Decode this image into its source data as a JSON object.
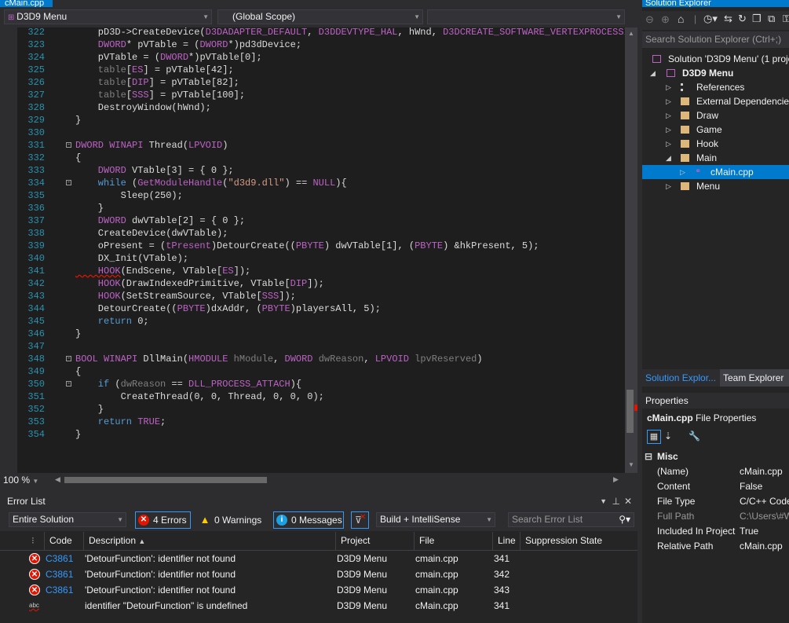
{
  "tab": {
    "title": "cMain.cpp"
  },
  "nav": {
    "project_combo": "D3D9 Menu",
    "scope_combo": "(Global Scope)",
    "member_combo": ""
  },
  "editor": {
    "lines": [
      {
        "n": "322",
        "tokens": [
          [
            "d",
            "    pD3D->CreateDevice("
          ],
          [
            "m",
            "D3DADAPTER_DEFAULT"
          ],
          [
            "d",
            ", "
          ],
          [
            "m",
            "D3DDEVTYPE_HAL"
          ],
          [
            "d",
            ", hWnd, "
          ],
          [
            "m",
            "D3DCREATE_SOFTWARE_VERTEXPROCESSING"
          ],
          [
            "d",
            ", "
          ]
        ]
      },
      {
        "n": "323",
        "tokens": [
          [
            "m",
            "    DWORD"
          ],
          [
            "d",
            "* pVTable = ("
          ],
          [
            "m",
            "DWORD"
          ],
          [
            "d",
            "*)pd3dDevice;"
          ]
        ]
      },
      {
        "n": "324",
        "tokens": [
          [
            "d",
            "    pVTable = ("
          ],
          [
            "m",
            "DWORD"
          ],
          [
            "d",
            "*)pVTable[0];"
          ]
        ]
      },
      {
        "n": "325",
        "tokens": [
          [
            "g",
            "    table"
          ],
          [
            "d",
            "["
          ],
          [
            "m",
            "ES"
          ],
          [
            "d",
            "] = pVTable[42];"
          ]
        ]
      },
      {
        "n": "326",
        "tokens": [
          [
            "g",
            "    table"
          ],
          [
            "d",
            "["
          ],
          [
            "m",
            "DIP"
          ],
          [
            "d",
            "] = pVTable[82];"
          ]
        ]
      },
      {
        "n": "327",
        "tokens": [
          [
            "g",
            "    table"
          ],
          [
            "d",
            "["
          ],
          [
            "m",
            "SSS"
          ],
          [
            "d",
            "] = pVTable[100];"
          ]
        ]
      },
      {
        "n": "328",
        "tokens": [
          [
            "d",
            "    DestroyWindow(hWnd);"
          ]
        ]
      },
      {
        "n": "329",
        "tokens": [
          [
            "d",
            "}"
          ]
        ]
      },
      {
        "n": "330",
        "tokens": []
      },
      {
        "n": "331",
        "fold": "-",
        "tokens": [
          [
            "m",
            "DWORD "
          ],
          [
            "m",
            "WINAPI"
          ],
          [
            "d",
            " Thread("
          ],
          [
            "m",
            "LPVOID"
          ],
          [
            "d",
            ")"
          ]
        ]
      },
      {
        "n": "332",
        "tokens": [
          [
            "d",
            "{"
          ]
        ]
      },
      {
        "n": "333",
        "tokens": [
          [
            "m",
            "    DWORD"
          ],
          [
            "d",
            " VTable[3] = { 0 };"
          ]
        ]
      },
      {
        "n": "334",
        "fold": "-",
        "tokens": [
          [
            "k",
            "    while"
          ],
          [
            "d",
            " ("
          ],
          [
            "m",
            "GetModuleHandle"
          ],
          [
            "d",
            "("
          ],
          [
            "s",
            "\"d3d9.dll\""
          ],
          [
            "d",
            ") == "
          ],
          [
            "m",
            "NULL"
          ],
          [
            "d",
            "){"
          ]
        ]
      },
      {
        "n": "335",
        "tokens": [
          [
            "d",
            "        Sleep(250);"
          ]
        ]
      },
      {
        "n": "336",
        "tokens": [
          [
            "d",
            "    }"
          ]
        ]
      },
      {
        "n": "337",
        "tokens": [
          [
            "m",
            "    DWORD"
          ],
          [
            "d",
            " dwVTable[2] = { 0 };"
          ]
        ]
      },
      {
        "n": "338",
        "tokens": [
          [
            "d",
            "    CreateDevice(dwVTable);"
          ]
        ]
      },
      {
        "n": "339",
        "tokens": [
          [
            "d",
            "    oPresent = ("
          ],
          [
            "m",
            "tPresent"
          ],
          [
            "d",
            ")DetourCreate(("
          ],
          [
            "m",
            "PBYTE"
          ],
          [
            "d",
            ") dwVTable[1], ("
          ],
          [
            "m",
            "PBYTE"
          ],
          [
            "d",
            ") &hkPresent, 5);"
          ]
        ]
      },
      {
        "n": "340",
        "tokens": [
          [
            "d",
            "    DX_Init(VTable);"
          ]
        ]
      },
      {
        "n": "341",
        "tokens": [
          [
            "e",
            "    HOOK"
          ],
          [
            "d",
            "(EndScene, VTable["
          ],
          [
            "m",
            "ES"
          ],
          [
            "d",
            "]);"
          ]
        ]
      },
      {
        "n": "342",
        "tokens": [
          [
            "m",
            "    HOOK"
          ],
          [
            "d",
            "(DrawIndexedPrimitive, VTable["
          ],
          [
            "m",
            "DIP"
          ],
          [
            "d",
            "]);"
          ]
        ]
      },
      {
        "n": "343",
        "tokens": [
          [
            "m",
            "    HOOK"
          ],
          [
            "d",
            "(SetStreamSource, VTable["
          ],
          [
            "m",
            "SSS"
          ],
          [
            "d",
            "]);"
          ]
        ]
      },
      {
        "n": "344",
        "tokens": [
          [
            "d",
            "    DetourCreate(("
          ],
          [
            "m",
            "PBYTE"
          ],
          [
            "d",
            ")dxAddr, ("
          ],
          [
            "m",
            "PBYTE"
          ],
          [
            "d",
            ")playersAll, 5);"
          ]
        ]
      },
      {
        "n": "345",
        "tokens": [
          [
            "k",
            "    return"
          ],
          [
            "d",
            " 0;"
          ]
        ]
      },
      {
        "n": "346",
        "tokens": [
          [
            "d",
            "}"
          ]
        ]
      },
      {
        "n": "347",
        "tokens": []
      },
      {
        "n": "348",
        "fold": "-",
        "tokens": [
          [
            "m",
            "BOOL "
          ],
          [
            "m",
            "WINAPI"
          ],
          [
            "d",
            " DllMain("
          ],
          [
            "m",
            "HMODULE"
          ],
          [
            "d",
            " "
          ],
          [
            "g",
            "hModule"
          ],
          [
            "d",
            ", "
          ],
          [
            "m",
            "DWORD"
          ],
          [
            "d",
            " "
          ],
          [
            "g",
            "dwReason"
          ],
          [
            "d",
            ", "
          ],
          [
            "m",
            "LPVOID"
          ],
          [
            "d",
            " "
          ],
          [
            "g",
            "lpvReserved"
          ],
          [
            "d",
            ")"
          ]
        ]
      },
      {
        "n": "349",
        "tokens": [
          [
            "d",
            "{"
          ]
        ]
      },
      {
        "n": "350",
        "fold": "-",
        "tokens": [
          [
            "k",
            "    if"
          ],
          [
            "d",
            " ("
          ],
          [
            "g",
            "dwReason"
          ],
          [
            "d",
            " == "
          ],
          [
            "m",
            "DLL_PROCESS_ATTACH"
          ],
          [
            "d",
            "){"
          ]
        ]
      },
      {
        "n": "351",
        "tokens": [
          [
            "d",
            "        CreateThread(0, 0, Thread, 0, 0, 0);"
          ]
        ]
      },
      {
        "n": "352",
        "tokens": [
          [
            "d",
            "    }"
          ]
        ]
      },
      {
        "n": "353",
        "tokens": [
          [
            "k",
            "    return"
          ],
          [
            "d",
            " "
          ],
          [
            "m",
            "TRUE"
          ],
          [
            "d",
            ";"
          ]
        ]
      },
      {
        "n": "354",
        "tokens": [
          [
            "d",
            "}"
          ]
        ]
      }
    ],
    "zoom": "100 %"
  },
  "errorlist": {
    "title": "Error List",
    "scope": "Entire Solution",
    "errors_btn": "4 Errors",
    "warnings_btn": "0 Warnings",
    "messages_btn": "0 Messages",
    "build_combo": "Build + IntelliSense",
    "search_placeholder": "Search Error List",
    "columns": {
      "code": "Code",
      "description": "Description",
      "project": "Project",
      "file": "File",
      "line": "Line",
      "suppression": "Suppression State"
    },
    "rows": [
      {
        "kind": "error",
        "code": "C3861",
        "description": "'DetourFunction': identifier not found",
        "project": "D3D9 Menu",
        "file": "cmain.cpp",
        "line": "341"
      },
      {
        "kind": "error",
        "code": "C3861",
        "description": "'DetourFunction': identifier not found",
        "project": "D3D9 Menu",
        "file": "cmain.cpp",
        "line": "342"
      },
      {
        "kind": "error",
        "code": "C3861",
        "description": "'DetourFunction': identifier not found",
        "project": "D3D9 Menu",
        "file": "cmain.cpp",
        "line": "343"
      },
      {
        "kind": "intellisense",
        "code": "",
        "description": "identifier \"DetourFunction\" is undefined",
        "project": "D3D9 Menu",
        "file": "cMain.cpp",
        "line": "341"
      }
    ]
  },
  "solution_explorer": {
    "title": "Solution Explorer",
    "search_placeholder": "Search Solution Explorer (Ctrl+;)",
    "solution": "Solution 'D3D9 Menu' (1 proje",
    "project": "D3D9 Menu",
    "items": [
      "References",
      "External Dependencies",
      "Draw",
      "Game",
      "Hook",
      "Main",
      "cMain.cpp",
      "Menu"
    ],
    "tabs": [
      "Solution Explor...",
      "Team Explorer"
    ]
  },
  "properties": {
    "title": "Properties",
    "object_name": "cMain.cpp",
    "object_type": "File Properties",
    "category": "Misc",
    "rows": [
      {
        "name": "(Name)",
        "value": "cMain.cpp"
      },
      {
        "name": "Content",
        "value": "False"
      },
      {
        "name": "File Type",
        "value": "C/C++ Code"
      },
      {
        "name": "Full Path",
        "value": "C:\\Users\\#W"
      },
      {
        "name": "Included In Project",
        "value": "True"
      },
      {
        "name": "Relative Path",
        "value": "cMain.cpp"
      }
    ]
  },
  "colors": {
    "accent": "#007acc",
    "error": "#e51400",
    "selection": "#3399ff"
  }
}
